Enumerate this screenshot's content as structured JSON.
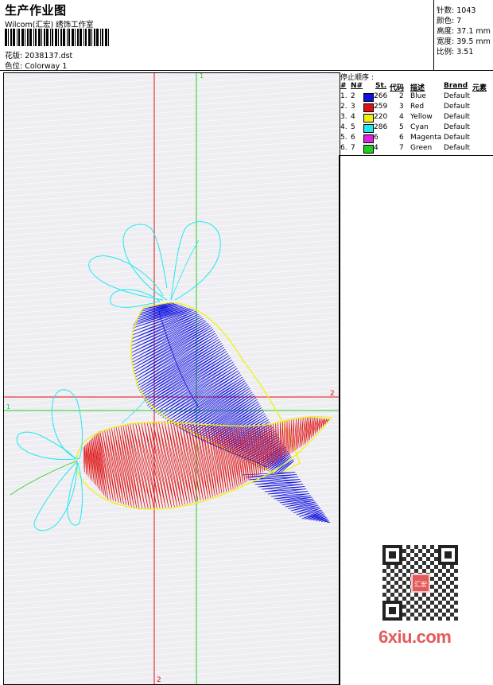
{
  "header": {
    "title": "生产作业图",
    "studio": "Wilcom(汇宏) 绣饰工作室",
    "design_file_label": "花版:",
    "design_file": "2038137.dst",
    "colorway_label": "色位:",
    "colorway": "Colorway 1"
  },
  "stats": {
    "stitches_label": "针数:",
    "stitches": "1043",
    "colors_label": "颜色:",
    "colors": "7",
    "height_label": "高度:",
    "height": "37.1 mm",
    "width_label": "宽度:",
    "width": "39.5 mm",
    "ratio_label": "比例:",
    "ratio": "3.51"
  },
  "legend": {
    "title": "停止顺序 :",
    "headers": {
      "num": "#",
      "n": "N#",
      "st": "St.",
      "code": "代码",
      "desc": "描述",
      "brand": "Brand",
      "element": "元素"
    },
    "rows": [
      {
        "num": "1.",
        "n": "2",
        "color": "#1010e0",
        "st": "266",
        "code": "2",
        "desc": "Blue",
        "brand": "Default"
      },
      {
        "num": "2.",
        "n": "3",
        "color": "#e01010",
        "st": "259",
        "code": "3",
        "desc": "Red",
        "brand": "Default"
      },
      {
        "num": "3.",
        "n": "4",
        "color": "#f0f010",
        "st": "220",
        "code": "4",
        "desc": "Yellow",
        "brand": "Default"
      },
      {
        "num": "4.",
        "n": "5",
        "color": "#20e8f0",
        "st": "286",
        "code": "5",
        "desc": "Cyan",
        "brand": "Default"
      },
      {
        "num": "5.",
        "n": "6",
        "color": "#e020e0",
        "st": "6",
        "code": "6",
        "desc": "Magenta",
        "brand": "Default"
      },
      {
        "num": "6.",
        "n": "7",
        "color": "#20d020",
        "st": "4",
        "code": "7",
        "desc": "Green",
        "brand": "Default"
      }
    ]
  },
  "design": {
    "guide_labels": {
      "green_v_top": "1",
      "green_h_left": "1",
      "red_h_right": "2",
      "red_v_bottom": "2"
    },
    "guide_colors": {
      "red": "#e01010",
      "green": "#20d020"
    },
    "thread_colors": {
      "blue": "#1010e0",
      "red": "#e01010",
      "yellow": "#f0f010",
      "cyan": "#20e8f0"
    }
  },
  "watermark": {
    "text": "6xiu.com",
    "stamp": "汇宏"
  }
}
